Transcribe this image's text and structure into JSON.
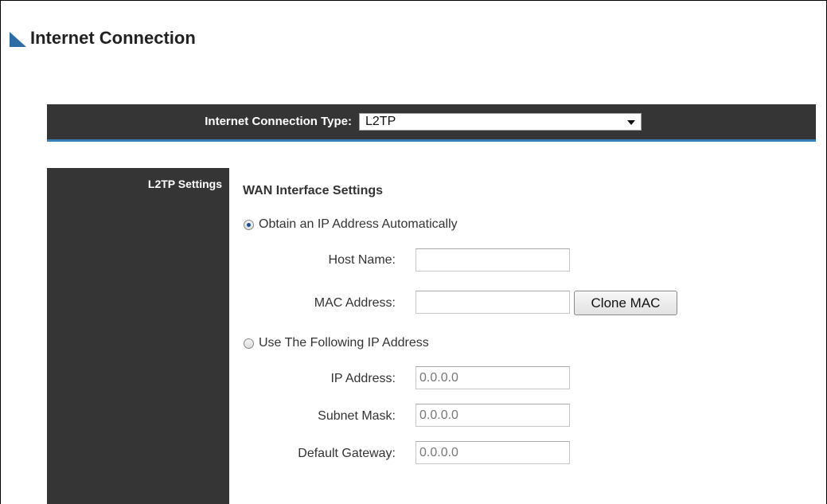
{
  "page": {
    "title": "Internet Connection"
  },
  "connection_type": {
    "label": "Internet Connection Type:",
    "selected": "L2TP"
  },
  "settings": {
    "side_label": "L2TP Settings",
    "heading": "WAN Interface Settings",
    "option_auto": {
      "label": "Obtain an IP Address Automatically",
      "checked": true
    },
    "host_name": {
      "label": "Host Name:",
      "value": ""
    },
    "mac_address": {
      "label": "MAC Address:",
      "value": ""
    },
    "clone_mac_label": "Clone MAC",
    "option_static": {
      "label": "Use The Following IP Address",
      "checked": false
    },
    "ip_address": {
      "label": "IP Address:",
      "value": "0.0.0.0"
    },
    "subnet_mask": {
      "label": "Subnet Mask:",
      "value": "0.0.0.0"
    },
    "default_gateway": {
      "label": "Default Gateway:",
      "value": "0.0.0.0"
    }
  },
  "colors": {
    "panel": "#353535",
    "accent": "#3a7fb5",
    "title_icon": "#2e6da4"
  }
}
